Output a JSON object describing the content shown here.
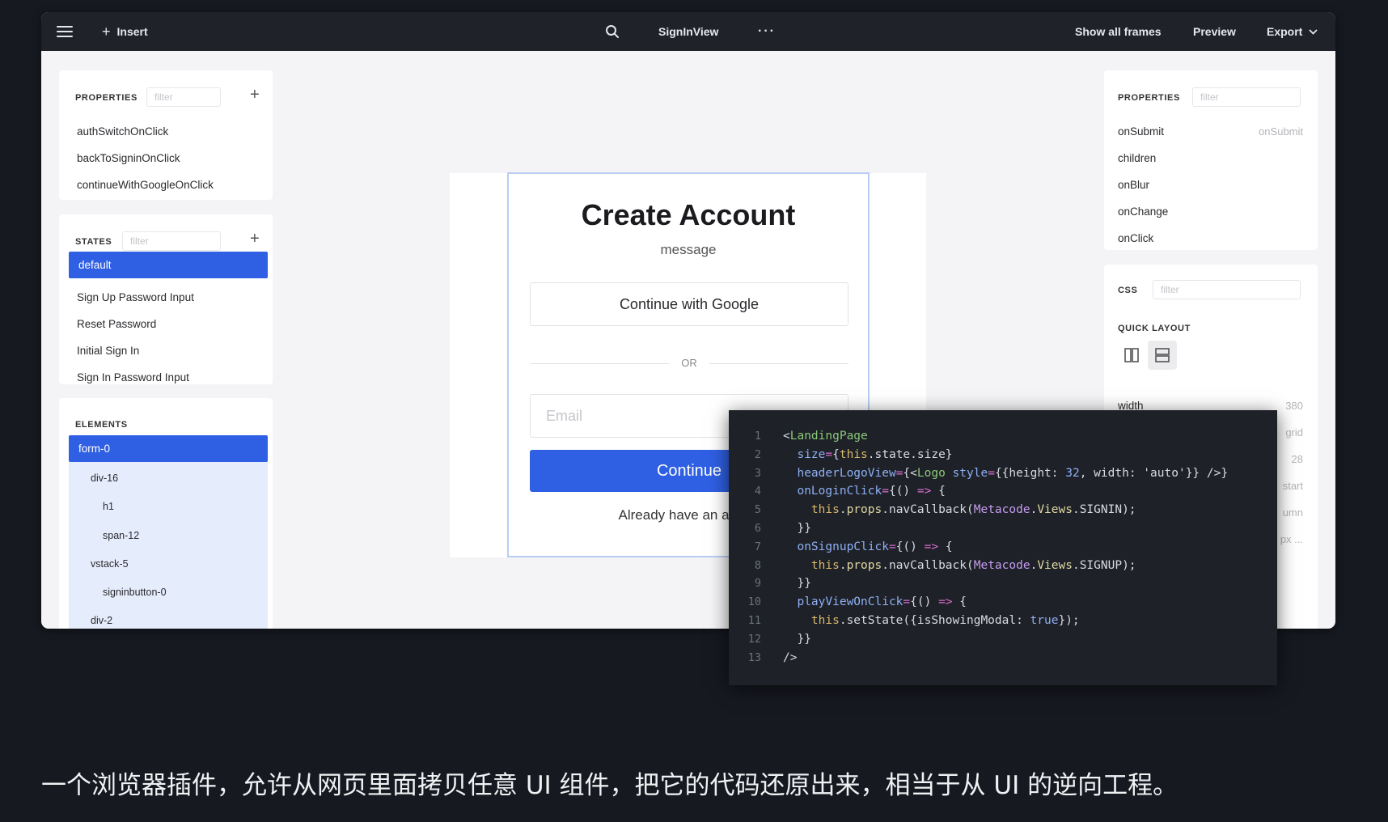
{
  "topbar": {
    "insert": "Insert",
    "frame_name": "SignInView",
    "more": "···",
    "show_all_frames": "Show all frames",
    "preview": "Preview",
    "export": "Export"
  },
  "left_panel": {
    "properties_title": "PROPERTIES",
    "filter_placeholder": "filter",
    "properties": [
      "authSwitchOnClick",
      "backToSigninOnClick",
      "continueWithGoogleOnClick"
    ],
    "states_title": "STATES",
    "states": [
      "default",
      "Sign Up Password Input",
      "Reset Password",
      "Initial Sign In",
      "Sign In Password Input"
    ],
    "elements_title": "ELEMENTS",
    "elements": [
      "form-0",
      "div-16",
      "h1",
      "span-12",
      "vstack-5",
      "signinbutton-0",
      "div-2"
    ]
  },
  "right_panel": {
    "properties_title": "PROPERTIES",
    "filter_placeholder": "filter",
    "properties": [
      {
        "name": "onSubmit",
        "value": "onSubmit"
      },
      {
        "name": "children",
        "value": ""
      },
      {
        "name": "onBlur",
        "value": ""
      },
      {
        "name": "onChange",
        "value": ""
      },
      {
        "name": "onClick",
        "value": ""
      }
    ],
    "css_title": "CSS",
    "quick_layout_title": "QUICK LAYOUT",
    "width_label": "width",
    "width_value": "380",
    "partial_values": [
      "grid",
      "28",
      "start",
      "umn",
      "px ..."
    ]
  },
  "canvas": {
    "title": "Create Account",
    "message": "message",
    "google_button": "Continue with Google",
    "divider": "OR",
    "email_placeholder": "Email",
    "continue_button": "Continue",
    "already_text": "Already have an accou"
  },
  "code": {
    "lines": [
      [
        [
          "c-pun",
          "<"
        ],
        [
          "c-tag",
          "LandingPage"
        ]
      ],
      [
        [
          "c-pun",
          "  "
        ],
        [
          "c-attr",
          "size"
        ],
        [
          "c-op",
          "="
        ],
        [
          "c-pun",
          "{"
        ],
        [
          "c-kw",
          "this"
        ],
        [
          "c-pun",
          ".state.size}"
        ]
      ],
      [
        [
          "c-pun",
          "  "
        ],
        [
          "c-attr",
          "headerLogoView"
        ],
        [
          "c-op",
          "="
        ],
        [
          "c-pun",
          "{<"
        ],
        [
          "c-tag",
          "Logo"
        ],
        [
          "c-pun",
          " "
        ],
        [
          "c-attr",
          "style"
        ],
        [
          "c-op",
          "="
        ],
        [
          "c-pun",
          "{{height: "
        ],
        [
          "c-num",
          "32"
        ],
        [
          "c-pun",
          ", width: "
        ],
        [
          "c-str",
          "'auto'"
        ],
        [
          "c-pun",
          "}} />}"
        ]
      ],
      [
        [
          "c-pun",
          "  "
        ],
        [
          "c-attr",
          "onLoginClick"
        ],
        [
          "c-op",
          "="
        ],
        [
          "c-pun",
          "{() "
        ],
        [
          "c-op",
          "=>"
        ],
        [
          "c-pun",
          " {"
        ]
      ],
      [
        [
          "c-pun",
          "    "
        ],
        [
          "c-kw",
          "this"
        ],
        [
          "c-pun",
          "."
        ],
        [
          "c-prop",
          "props"
        ],
        [
          "c-pun",
          ".navCallback("
        ],
        [
          "c-cls",
          "Metacode"
        ],
        [
          "c-pun",
          "."
        ],
        [
          "c-prop",
          "Views"
        ],
        [
          "c-pun",
          ".SIGNIN);"
        ]
      ],
      [
        [
          "c-pun",
          "  }}"
        ]
      ],
      [
        [
          "c-pun",
          "  "
        ],
        [
          "c-attr",
          "onSignupClick"
        ],
        [
          "c-op",
          "="
        ],
        [
          "c-pun",
          "{() "
        ],
        [
          "c-op",
          "=>"
        ],
        [
          "c-pun",
          " {"
        ]
      ],
      [
        [
          "c-pun",
          "    "
        ],
        [
          "c-kw",
          "this"
        ],
        [
          "c-pun",
          "."
        ],
        [
          "c-prop",
          "props"
        ],
        [
          "c-pun",
          ".navCallback("
        ],
        [
          "c-cls",
          "Metacode"
        ],
        [
          "c-pun",
          "."
        ],
        [
          "c-prop",
          "Views"
        ],
        [
          "c-pun",
          ".SIGNUP);"
        ]
      ],
      [
        [
          "c-pun",
          "  }}"
        ]
      ],
      [
        [
          "c-pun",
          "  "
        ],
        [
          "c-attr",
          "playViewOnClick"
        ],
        [
          "c-op",
          "="
        ],
        [
          "c-pun",
          "{() "
        ],
        [
          "c-op",
          "=>"
        ],
        [
          "c-pun",
          " {"
        ]
      ],
      [
        [
          "c-pun",
          "    "
        ],
        [
          "c-kw",
          "this"
        ],
        [
          "c-pun",
          ".setState({isShowingModal: "
        ],
        [
          "c-attr",
          "true"
        ],
        [
          "c-pun",
          "});"
        ]
      ],
      [
        [
          "c-pun",
          "  }}"
        ]
      ],
      [
        [
          "c-pun",
          "/>"
        ]
      ]
    ]
  },
  "caption": "一个浏览器插件，允许从网页里面拷贝任意 UI 组件，把它的代码还原出来，相当于从 UI 的逆向工程。"
}
